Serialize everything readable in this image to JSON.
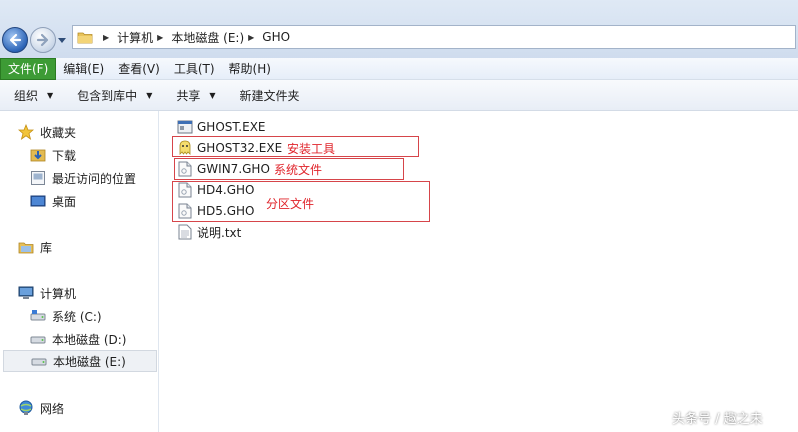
{
  "address": {
    "crumbs": [
      "计算机",
      "本地磁盘 (E:)",
      "GHO"
    ]
  },
  "menu": {
    "items": [
      "文件(F)",
      "编辑(E)",
      "查看(V)",
      "工具(T)",
      "帮助(H)"
    ]
  },
  "commands": {
    "organize": "组织",
    "include_library": "包含到库中",
    "share": "共享",
    "new_folder": "新建文件夹"
  },
  "sidebar": {
    "favorites": "收藏夹",
    "downloads": "下载",
    "recent": "最近访问的位置",
    "desktop": "桌面",
    "libraries": "库",
    "computer": "计算机",
    "drive_c": "系统 (C:)",
    "drive_d": "本地磁盘 (D:)",
    "drive_e": "本地磁盘 (E:)",
    "network": "网络"
  },
  "files": [
    "GHOST.EXE",
    "GHOST32.EXE",
    "GWIN7.GHO",
    "HD4.GHO",
    "HD5.GHO",
    "说明.txt"
  ],
  "annotations": {
    "install_tool": "安装工具",
    "system_file": "系统文件",
    "partition_file": "分区文件"
  },
  "watermark": "头条号 / 趣之未",
  "colors": {
    "annotation_red": "#e0242b",
    "active_menu_green": "#3d9b35"
  }
}
